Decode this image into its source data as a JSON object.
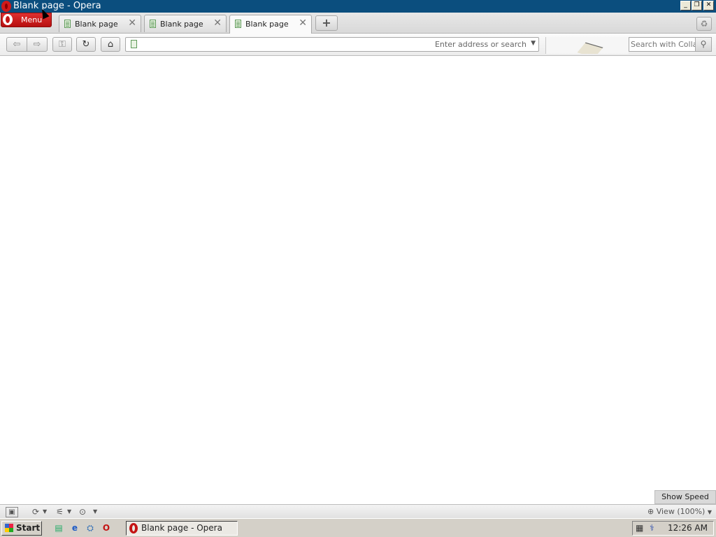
{
  "window": {
    "title": "Blank page - Opera",
    "minimize_glyph": "_",
    "restore_glyph": "❐",
    "close_glyph": "✕"
  },
  "menu": {
    "label": "Menu"
  },
  "tabs": [
    {
      "label": "Blank page",
      "close": "✕",
      "active": false
    },
    {
      "label": "Blank page",
      "close": "✕",
      "active": false
    },
    {
      "label": "Blank page",
      "close": "✕",
      "active": true
    }
  ],
  "newtab": {
    "label": "+"
  },
  "toolbar": {
    "back_icon": "arrow-left",
    "forward_icon": "arrow-right",
    "back_glyph": "⇦",
    "forward_glyph": "⇨",
    "key_glyph": "⚿",
    "reload_glyph": "↻",
    "home_glyph": "⌂"
  },
  "address": {
    "value": "",
    "hint": "Enter address or search",
    "dropdown_glyph": "▼"
  },
  "search": {
    "placeholder": "Search with Collab",
    "button_glyph": "⚲"
  },
  "speed_dial": {
    "label": "Show Speed Dial"
  },
  "statusbar": {
    "zoom_label": "View (100%)",
    "panel_glyph": "▣",
    "sync_glyph": "⟳",
    "share_glyph": "⚟",
    "turbo_glyph": "⊙"
  },
  "taskbar": {
    "start_label": "Start",
    "task_label": "Blank page - Opera",
    "clock": "12:26 AM"
  }
}
